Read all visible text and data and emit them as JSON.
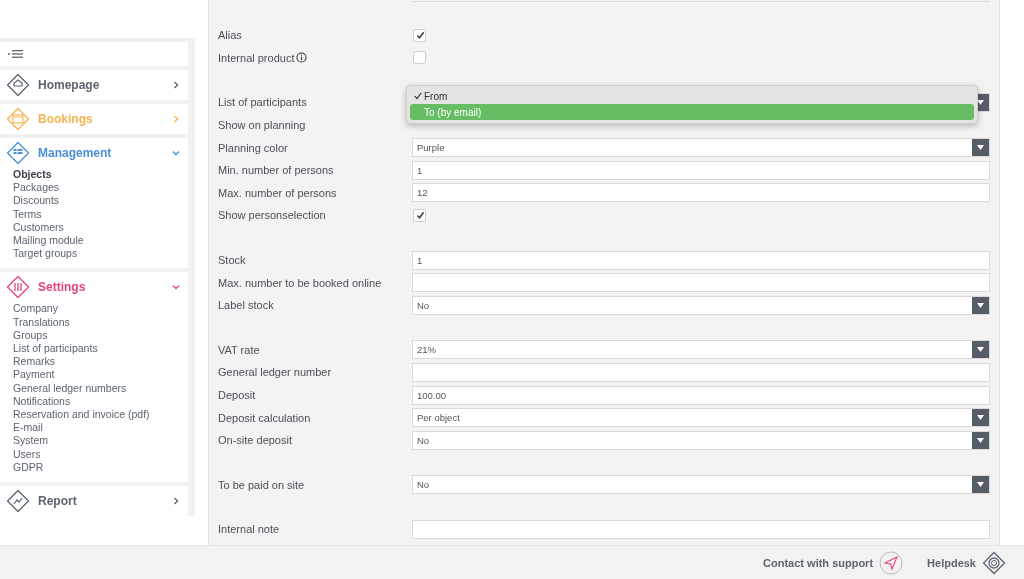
{
  "sidebar": {
    "sections": [
      {
        "label": "Homepage",
        "color": "#5b6470",
        "expanded": false
      },
      {
        "label": "Bookings",
        "color": "#f5b44f",
        "expanded": false
      },
      {
        "label": "Management",
        "color": "#4a8fd6",
        "expanded": true,
        "items": [
          {
            "label": "Objects",
            "selected": true
          },
          {
            "label": "Packages",
            "selected": false
          },
          {
            "label": "Discounts",
            "selected": false
          },
          {
            "label": "Terms",
            "selected": false
          },
          {
            "label": "Customers",
            "selected": false
          },
          {
            "label": "Mailing module",
            "selected": false
          },
          {
            "label": "Target groups",
            "selected": false
          }
        ]
      },
      {
        "label": "Settings",
        "color": "#e5457a",
        "expanded": true,
        "items": [
          {
            "label": "Company",
            "selected": false
          },
          {
            "label": "Translations",
            "selected": false
          },
          {
            "label": "Groups",
            "selected": false
          },
          {
            "label": "List of participants",
            "selected": false
          },
          {
            "label": "Remarks",
            "selected": false
          },
          {
            "label": "Payment",
            "selected": false
          },
          {
            "label": "General ledger numbers",
            "selected": false
          },
          {
            "label": "Notifications",
            "selected": false
          },
          {
            "label": "Reservation and invoice (pdf)",
            "selected": false
          },
          {
            "label": "E-mail",
            "selected": false
          },
          {
            "label": "System",
            "selected": false
          },
          {
            "label": "Users",
            "selected": false
          },
          {
            "label": "GDPR",
            "selected": false
          }
        ]
      },
      {
        "label": "Report",
        "color": "#5b6470",
        "expanded": false
      }
    ]
  },
  "form": {
    "sections": [
      {
        "rows": [
          {
            "label": "Alias",
            "kind": "checkbox",
            "checked": true
          },
          {
            "label": "Internal product",
            "info_icon": true,
            "kind": "checkbox",
            "checked": false
          }
        ]
      },
      {
        "rows": [
          {
            "label": "List of participants",
            "kind": "open-select",
            "options": [
              {
                "label": "From",
                "checked": true,
                "selected": false
              },
              {
                "label": "To (by email)",
                "checked": false,
                "selected": true
              }
            ]
          },
          {
            "label": "Show on planning",
            "kind": "covered"
          },
          {
            "label": "Planning color",
            "kind": "select",
            "value": "Purple"
          },
          {
            "label": "Min. number of persons",
            "kind": "text",
            "value": "1"
          },
          {
            "label": "Max. number of persons",
            "kind": "text",
            "value": "12"
          },
          {
            "label": "Show personselection",
            "kind": "checkbox",
            "checked": true
          }
        ]
      },
      {
        "rows": [
          {
            "label": "Stock",
            "kind": "text",
            "value": "1"
          },
          {
            "label": "Max. number to be booked online",
            "kind": "text"
          },
          {
            "label": "Label stock",
            "kind": "select",
            "value": "No"
          }
        ]
      },
      {
        "rows": [
          {
            "label": "VAT rate",
            "kind": "select",
            "value": "21%"
          },
          {
            "label": "General ledger number",
            "kind": "text"
          },
          {
            "label": "Deposit",
            "kind": "text",
            "value": "100.00"
          },
          {
            "label": "Deposit calculation",
            "kind": "select",
            "value": "Per object"
          },
          {
            "label": "On-site deposit",
            "kind": "select",
            "value": "No"
          }
        ]
      },
      {
        "rows": [
          {
            "label": "To be paid on site",
            "kind": "select",
            "value": "No"
          }
        ]
      },
      {
        "rows": [
          {
            "label": "Internal note",
            "kind": "text"
          }
        ]
      }
    ]
  },
  "footer": {
    "support": "Contact with support",
    "helpdesk": "Helpdesk"
  }
}
